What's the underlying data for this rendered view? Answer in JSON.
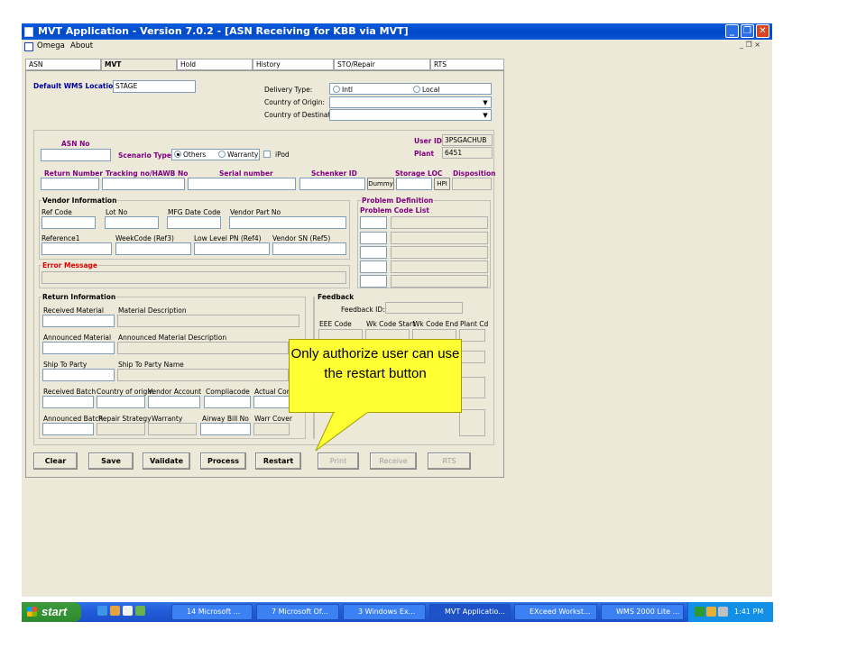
{
  "window": {
    "title": "MVT Application - Version 7.0.2 - [ASN Receiving for KBB via MVT]",
    "controls": {
      "minimize": "_",
      "maximize": "❐",
      "close": "✕"
    },
    "mdi_controls": "_ ❐ ×"
  },
  "menu": [
    "Omega",
    "About"
  ],
  "tabs": [
    "ASN",
    "MVT",
    "Hold",
    "History",
    "STO/Repair",
    "RTS"
  ],
  "top": {
    "wms_label": "Default WMS Location",
    "wms_value": "STAGE",
    "delivery_type_label": "Delivery Type:",
    "delivery_options": [
      "Intl",
      "Local"
    ],
    "country_origin_label": "Country of Origin:",
    "country_dest_label": "Country of Destination:"
  },
  "asn": {
    "asn_no_label": "ASN No",
    "scenario_label": "Scenario Type:",
    "scenario_options": [
      "Others",
      "Warranty"
    ],
    "ipod_label": "iPod",
    "user_id_label": "User ID",
    "user_id_value": "3PSGACHUB",
    "plant_label": "Plant",
    "plant_value": "6451",
    "return_number_label": "Return Number",
    "tracking_label": "Tracking no/HAWB No",
    "serial_label": "Serial number",
    "schenker_label": "Schenker ID",
    "storage_loc_label": "Storage LOC",
    "disposition_label": "Disposition",
    "dummy_button": "Dummy",
    "hpi_button": "HPI"
  },
  "vendor": {
    "title": "Vendor Information",
    "ref_code": "Ref Code",
    "lot_no": "Lot No",
    "mfg_date": "MFG Date Code",
    "vendor_part": "Vendor Part No",
    "reference1": "Reference1",
    "week_code": "WeekCode (Ref3)",
    "low_level": "Low Level PN (Ref4)",
    "vendor_sn": "Vendor SN (Ref5)"
  },
  "problem": {
    "title": "Problem Definition",
    "code_list": "Problem Code List"
  },
  "error": {
    "title": "Error Message"
  },
  "return_info": {
    "title": "Return Information",
    "received_material": "Received Material",
    "material_description": "Material Description",
    "announced_material": "Announced Material",
    "announced_description": "Announced Material Description",
    "ship_to_party": "Ship To Party",
    "ship_to_name": "Ship To Party Name",
    "received_batch": "Received Batch",
    "country_of_origin": "Country of origin",
    "vendor_account": "Vendor Account",
    "compliacode": "Compliacode",
    "actual_comp": "Actual Comp",
    "announced_batch": "Announced Batch",
    "repair_strategy": "Repair Strategy",
    "warranty": "Warranty",
    "airway_bill": "Airway Bill No",
    "warr_cover": "Warr Cover"
  },
  "feedback": {
    "title": "Feedback",
    "feedback_id": "Feedback ID:",
    "cols": [
      "EEE Code",
      "Wk Code Start",
      "Wk Code End",
      "Plant Cd"
    ]
  },
  "buttons": [
    "Clear",
    "Save",
    "Validate",
    "Process",
    "Restart",
    "Print",
    "Receive",
    "RTS"
  ],
  "callout": "Only authorize user can use the restart button",
  "taskbar": {
    "start": "start",
    "tasks": [
      "14 Microsoft ...",
      "7 Microsoft Of...",
      "3 Windows Ex...",
      "MVT Applicatio...",
      "EXceed Workst...",
      "WMS 2000 Lite ..."
    ],
    "clock": "1:41 PM"
  }
}
